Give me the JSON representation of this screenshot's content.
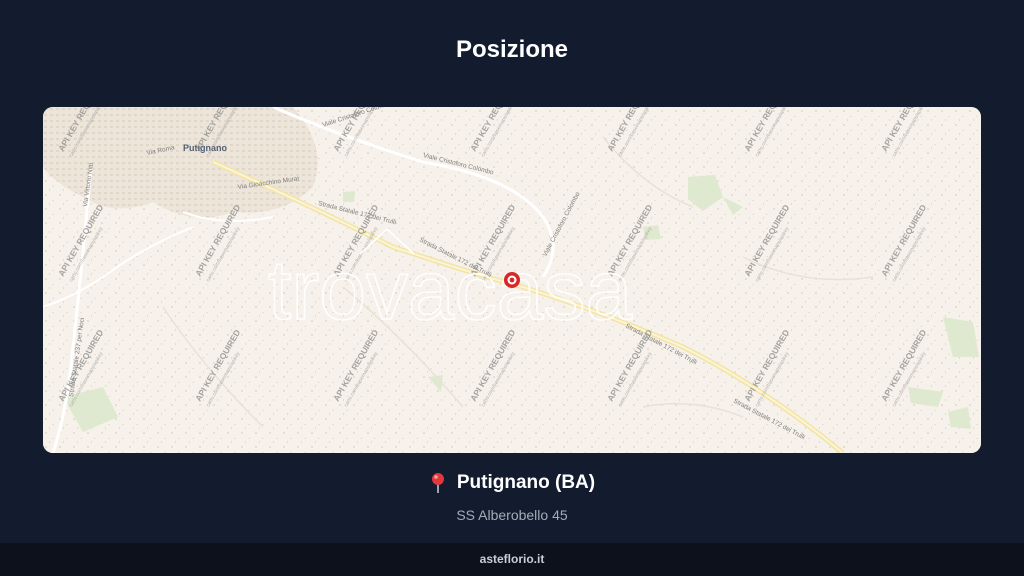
{
  "header": {
    "title": "Posizione"
  },
  "map": {
    "town_label": "Putignano",
    "road_labels": {
      "ss172_west": "Strada Statale 172 dei Trulli",
      "ss172_mid": "Strada Statale 172 dei Trulli",
      "ss172_east": "Strada Statale 172 dei Trulli",
      "ss172_far": "Strada Statale 172 dei Trulli",
      "colombo": "Viale Cristoforo Colombo",
      "colombo_north": "Viale Cristoforo Colombo",
      "colombo_south": "Viale Cristoforo Colombo",
      "murat": "Via Gioacchino Murat",
      "vittorio": "Via Vittorio Nitti",
      "ss237": "Strada Statale 237 per Noci",
      "pia": "Via Roma"
    },
    "watermark_brand": "trovacasa",
    "watermark_notice": "API KEY REQUIRED",
    "watermark_sub": "carto.com/basemaps/apikey",
    "marker_color": "#d62828"
  },
  "location": {
    "pin_icon": "map-pin-icon",
    "city": "Putignano (BA)",
    "address": "SS Alberobello 45"
  },
  "footer": {
    "site": "asteflorio.it"
  },
  "colors": {
    "background": "#131c2e",
    "map_base": "#f6f1ea",
    "road_main": "#f5e7a0",
    "footer": "#0c111c"
  }
}
